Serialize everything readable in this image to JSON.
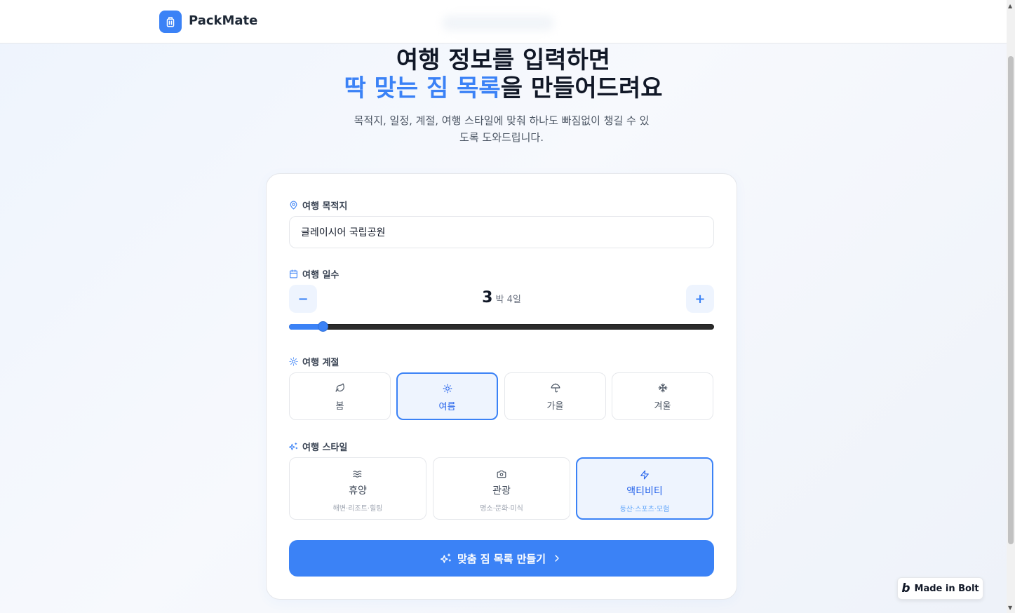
{
  "header": {
    "app_name": "PackMate"
  },
  "hero": {
    "title_line1": "여행 정보를 입력하면",
    "title_highlight": "딱 맞는 짐 목록",
    "title_rest": "을 만들어드려요",
    "subtitle_line1": "목적지, 일정, 계절, 여행 스타일에 맞춰 하나도 빠짐없이 챙길 수 있",
    "subtitle_line2": "도록 도와드립니다."
  },
  "form": {
    "destination": {
      "label": "여행 목적지",
      "value": "글레이시어 국립공원",
      "icon": "map-pin-icon"
    },
    "duration": {
      "label": "여행 일수",
      "icon": "calendar-icon",
      "nights": "3",
      "unit": "박 4일",
      "minus_label": "−",
      "plus_label": "+",
      "slider_fraction": 0.08
    },
    "season": {
      "label": "여행 계절",
      "icon": "sun-icon",
      "options": [
        {
          "label": "봄",
          "icon": "leaf-icon",
          "selected": false
        },
        {
          "label": "여름",
          "icon": "sun-icon",
          "selected": true
        },
        {
          "label": "가을",
          "icon": "umbrella-icon",
          "selected": false
        },
        {
          "label": "겨울",
          "icon": "snowflake-icon",
          "selected": false
        }
      ]
    },
    "style": {
      "label": "여행 스타일",
      "icon": "sparkles-icon",
      "options": [
        {
          "label": "휴양",
          "sub": "해변·리조트·힐링",
          "icon": "waves-icon",
          "selected": false
        },
        {
          "label": "관광",
          "sub": "명소·문화·미식",
          "icon": "camera-icon",
          "selected": false
        },
        {
          "label": "액티비티",
          "sub": "등산·스포츠·모험",
          "icon": "zap-icon",
          "selected": true
        }
      ]
    },
    "submit_label": "맞춤 짐 목록 만들기"
  },
  "badge": {
    "label": "Made in Bolt"
  },
  "colors": {
    "accent": "#3b82f6",
    "accent_light": "#eef4fe",
    "text": "#111827"
  }
}
